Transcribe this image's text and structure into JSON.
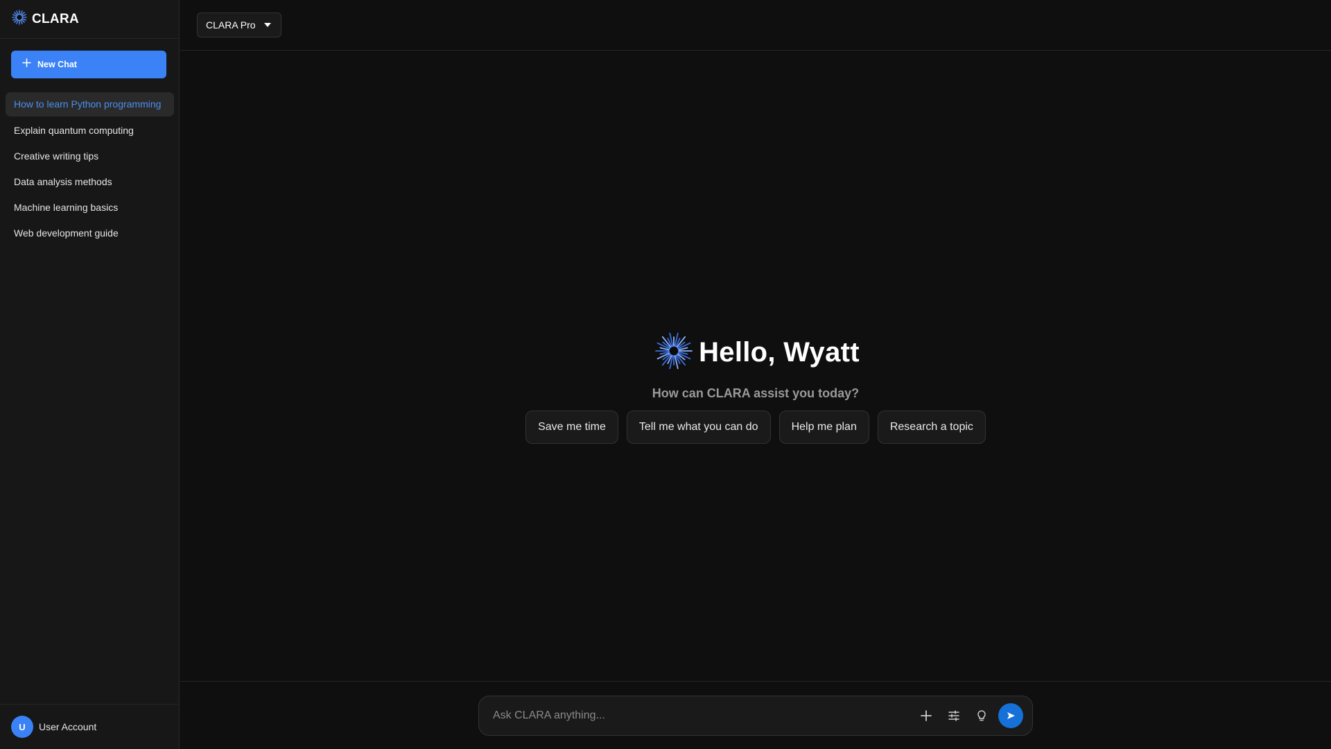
{
  "app": {
    "name": "CLARA"
  },
  "sidebar": {
    "new_chat_label": "New Chat",
    "history": [
      {
        "label": "How to learn Python programming",
        "active": true
      },
      {
        "label": "Explain quantum computing"
      },
      {
        "label": "Creative writing tips"
      },
      {
        "label": "Data analysis methods"
      },
      {
        "label": "Machine learning basics"
      },
      {
        "label": "Web development guide"
      }
    ],
    "account": {
      "initial": "U",
      "name": "User Account"
    }
  },
  "topbar": {
    "model": "CLARA Pro"
  },
  "main": {
    "greeting": "Hello, Wyatt",
    "subtitle": "How can CLARA assist you today?",
    "suggestions": [
      "Save me time",
      "Tell me what you can do",
      "Help me plan",
      "Research a topic"
    ]
  },
  "composer": {
    "placeholder": "Ask CLARA anything...",
    "icons": [
      "plus-icon",
      "sliders-icon",
      "lightbulb-icon",
      "send-icon"
    ]
  },
  "colors": {
    "accent": "#3b82f6",
    "send": "#1570d8",
    "background": "#0f0f0f",
    "sidebar": "#171717",
    "active_link": "#4d8ff0"
  }
}
